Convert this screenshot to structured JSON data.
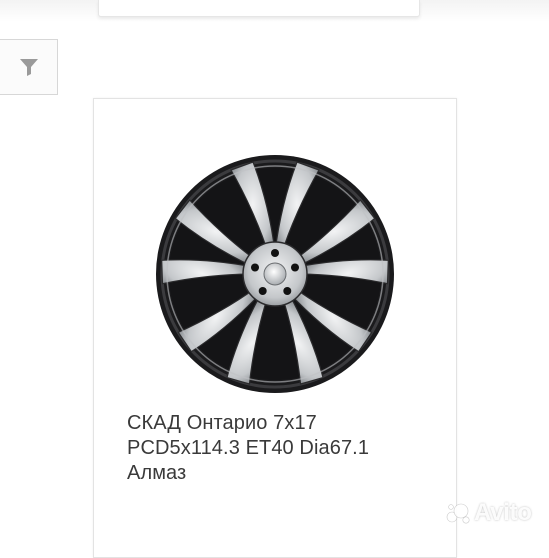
{
  "filter": {
    "icon": "funnel-filter-icon"
  },
  "product": {
    "image_alt": "wheel-rim",
    "title_lines": [
      "СКАД Онтарио 7x17",
      "PCD5x114.3 ET40 Dia67.1",
      "Алмаз"
    ]
  },
  "watermark": {
    "text": "Avito"
  },
  "colors": {
    "rim_dark": "#1c1c1e",
    "rim_silver": "#c9cbce",
    "text": "#3a3a3a"
  }
}
